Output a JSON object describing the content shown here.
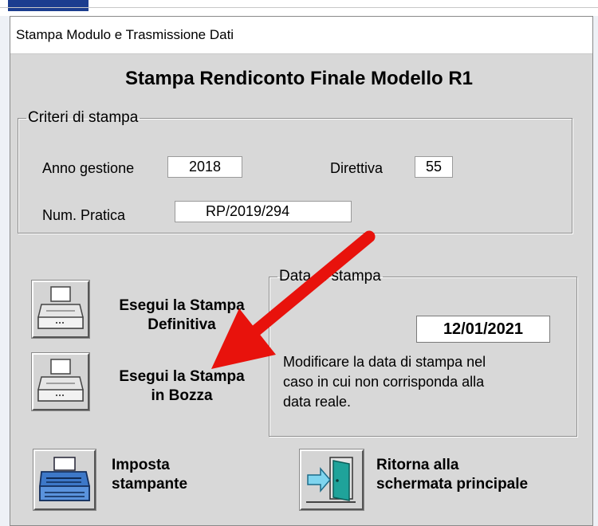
{
  "window": {
    "title": "Stampa Modulo e Trasmissione Dati",
    "heading": "Stampa Rendiconto Finale Modello R1"
  },
  "criteri": {
    "legend": "Criteri di stampa",
    "anno_label": "Anno gestione",
    "anno_value": "2018",
    "direttiva_label": "Direttiva",
    "direttiva_value": "55",
    "pratica_label": "Num. Pratica",
    "pratica_value": "RP/2019/294"
  },
  "buttons": {
    "definitiva_line1": "Esegui la Stampa",
    "definitiva_line2": "Definitiva",
    "bozza_line1": "Esegui la Stampa",
    "bozza_line2": "in Bozza",
    "imposta_line1": "Imposta",
    "imposta_line2": "stampante",
    "ritorna_line1": "Ritorna alla",
    "ritorna_line2": "schermata principale"
  },
  "data_stampa": {
    "legend": "Data di stampa",
    "value": "12/01/2021",
    "note_line1": "Modificare la data di stampa nel",
    "note_line2": "caso in cui non corrisponda alla",
    "note_line3": "data reale."
  },
  "colors": {
    "annotation_arrow": "#e8120c",
    "dialog_bg": "#d8d8d8",
    "app_tab": "#1b3d8f"
  },
  "icons": {
    "definitiva": "printer-icon",
    "bozza": "printer-icon",
    "imposta": "printer-setup-icon",
    "ritorna": "exit-door-icon"
  }
}
